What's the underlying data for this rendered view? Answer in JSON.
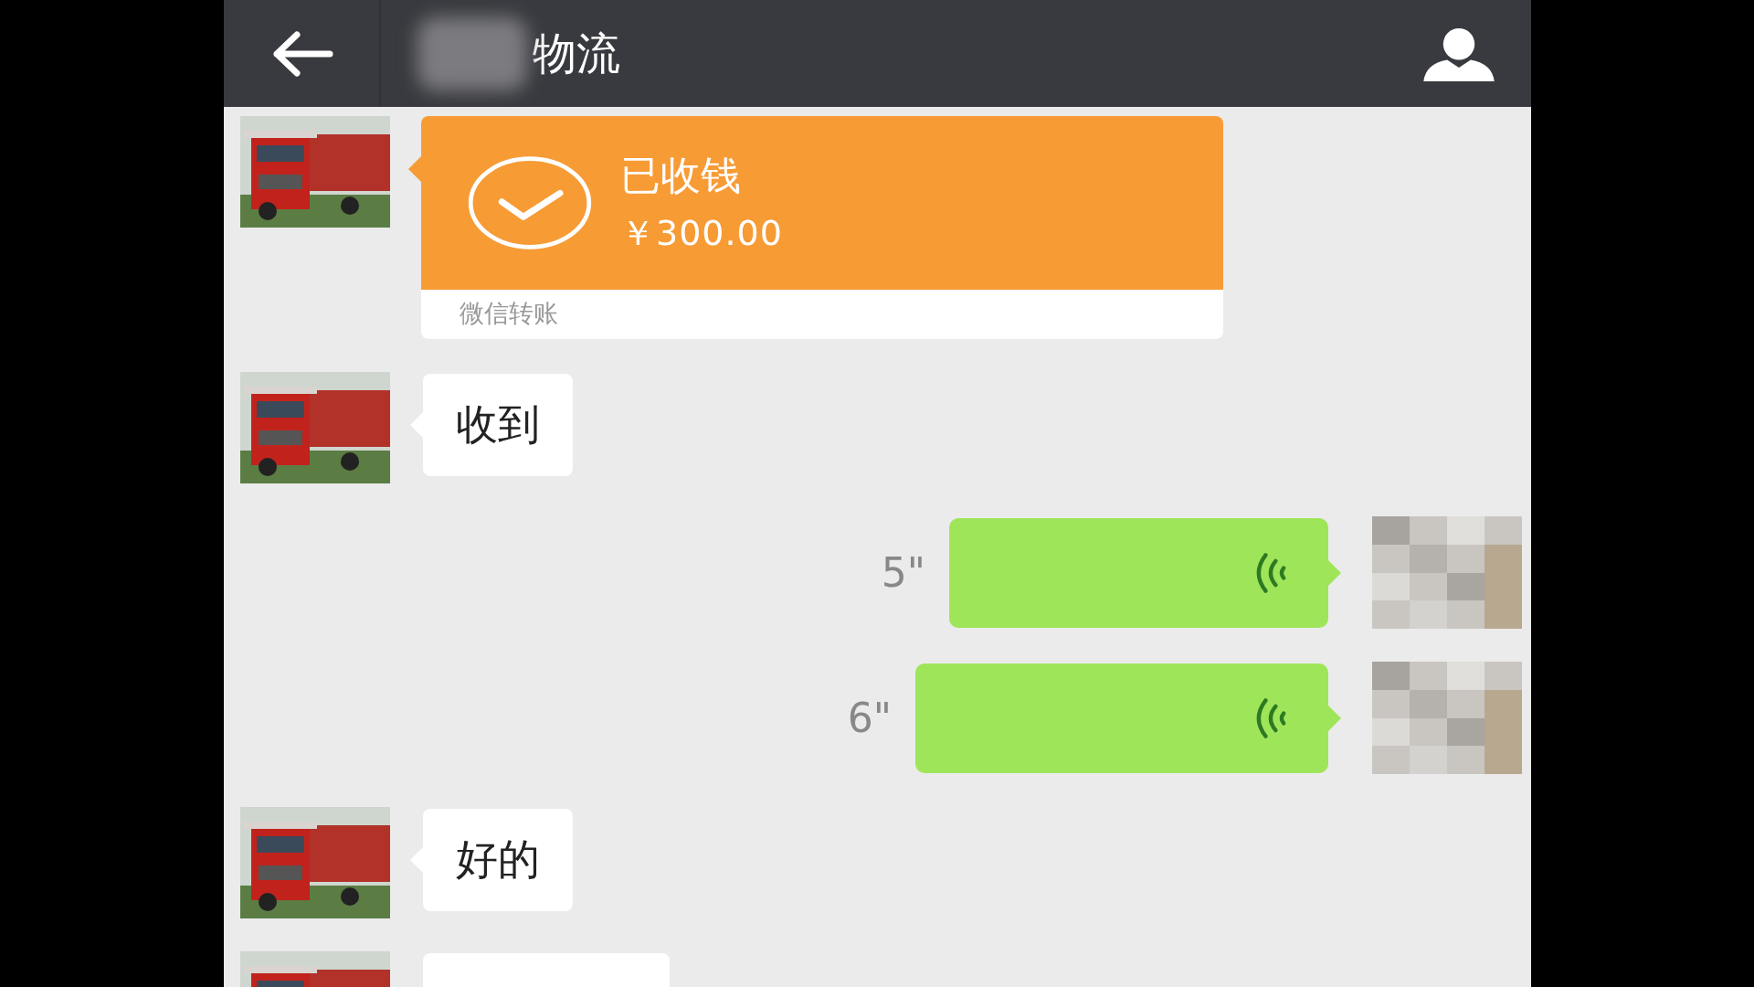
{
  "header": {
    "title": "物流"
  },
  "messages": [
    {
      "kind": "transfer",
      "status": "已收钱",
      "amount": "￥300.00",
      "footer": "微信转账"
    },
    {
      "kind": "text",
      "text": "收到"
    },
    {
      "kind": "voice",
      "duration": "5\""
    },
    {
      "kind": "voice",
      "duration": "6\""
    },
    {
      "kind": "text",
      "text": "好的"
    },
    {
      "kind": "cut"
    }
  ]
}
